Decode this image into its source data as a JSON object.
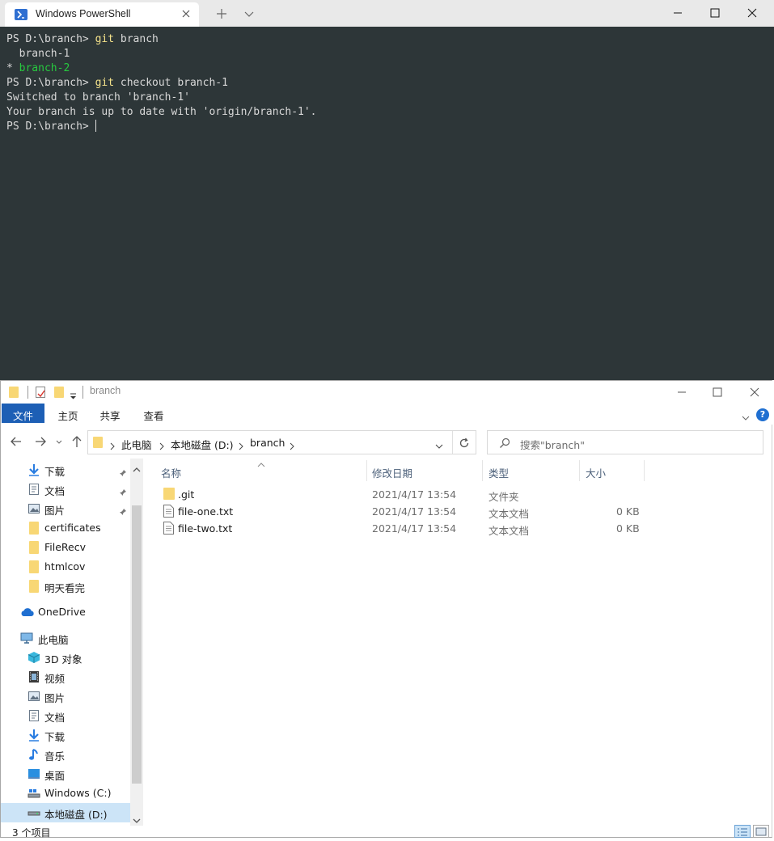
{
  "terminal": {
    "tab_title": "Windows PowerShell",
    "lines": [
      {
        "prompt": "PS D:\\branch> ",
        "cmd": "git branch"
      },
      {
        "text": "  branch-1"
      },
      {
        "star": "* ",
        "branch": "branch-2"
      },
      {
        "prompt": "PS D:\\branch> ",
        "cmd": "git checkout branch-1"
      },
      {
        "text": "Switched to branch 'branch-1'"
      },
      {
        "text": "Your branch is up to date with 'origin/branch-1'."
      },
      {
        "prompt": "PS D:\\branch> "
      }
    ]
  },
  "explorer": {
    "title": "branch",
    "ribbon_tabs": [
      "文件",
      "主页",
      "共享",
      "查看"
    ],
    "breadcrumb": [
      "此电脑",
      "本地磁盘 (D:)",
      "branch"
    ],
    "search_placeholder": "搜索\"branch\"",
    "sidebar": [
      {
        "label": "下载",
        "icon": "download-icon",
        "pinned": true
      },
      {
        "label": "文档",
        "icon": "document-icon",
        "pinned": true
      },
      {
        "label": "图片",
        "icon": "picture-icon",
        "pinned": true
      },
      {
        "label": "certificates",
        "icon": "folder-icon"
      },
      {
        "label": "FileRecv",
        "icon": "folder-icon"
      },
      {
        "label": "htmlcov",
        "icon": "folder-icon"
      },
      {
        "label": "明天看完",
        "icon": "folder-icon"
      },
      {
        "label": "OneDrive",
        "icon": "cloud-icon"
      },
      {
        "label": "此电脑",
        "icon": "computer-icon"
      },
      {
        "label": "3D 对象",
        "icon": "cube-icon"
      },
      {
        "label": "视频",
        "icon": "video-icon"
      },
      {
        "label": "图片",
        "icon": "picture-icon"
      },
      {
        "label": "文档",
        "icon": "document-icon"
      },
      {
        "label": "下载",
        "icon": "download-icon"
      },
      {
        "label": "音乐",
        "icon": "music-icon"
      },
      {
        "label": "桌面",
        "icon": "desktop-icon"
      },
      {
        "label": "Windows (C:)",
        "icon": "drive-icon"
      },
      {
        "label": "本地磁盘 (D:)",
        "icon": "drive-icon"
      }
    ],
    "columns": [
      "名称",
      "修改日期",
      "类型",
      "大小"
    ],
    "files": [
      {
        "name": ".git",
        "date": "2021/4/17 13:54",
        "type": "文件夹",
        "size": "",
        "kind": "folder"
      },
      {
        "name": "file-one.txt",
        "date": "2021/4/17 13:54",
        "type": "文本文档",
        "size": "0 KB",
        "kind": "text"
      },
      {
        "name": "file-two.txt",
        "date": "2021/4/17 13:54",
        "type": "文本文档",
        "size": "0 KB",
        "kind": "text"
      }
    ],
    "status": "3 个项目"
  }
}
